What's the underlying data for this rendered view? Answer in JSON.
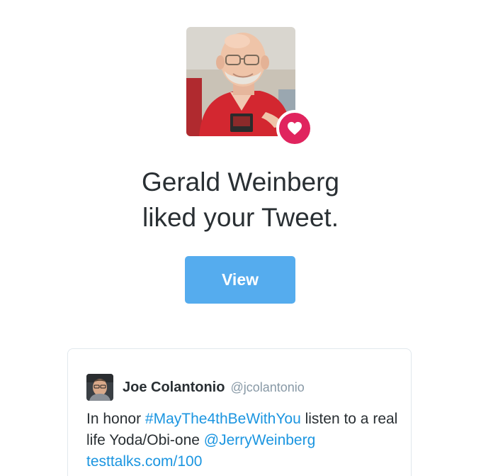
{
  "notification": {
    "actor_name": "Gerald Weinberg",
    "action_text": "liked your Tweet.",
    "badge_icon": "heart-icon",
    "badge_color": "#e0245e",
    "view_button_label": "View",
    "view_button_color": "#55acee"
  },
  "tweet": {
    "author_name": "Joe Colantonio",
    "author_handle": "@jcolantonio",
    "text_part1": "In honor ",
    "hashtag": "#MayThe4thBeWithYou",
    "text_part2": " listen to a real life Yoda/Obi-one ",
    "mention": "@JerryWeinberg",
    "url": "testtalks.com/100",
    "link_color": "#1b95e0"
  }
}
